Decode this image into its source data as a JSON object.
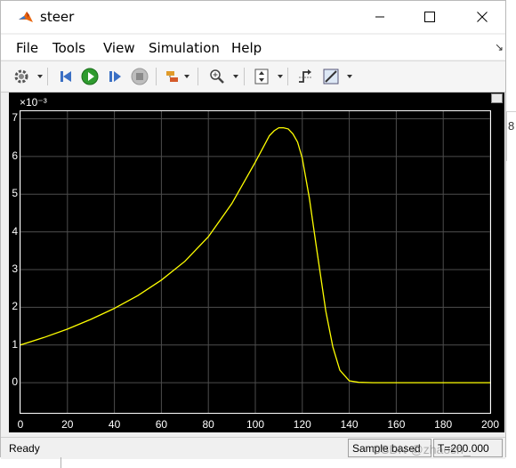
{
  "window": {
    "title": "steer"
  },
  "menu": {
    "file": "File",
    "tools": "Tools",
    "view": "View",
    "simulation": "Simulation",
    "help": "Help"
  },
  "toolbar": {
    "items": [
      "gear-icon",
      "step-back-icon",
      "run-icon",
      "step-forward-icon",
      "stop-icon",
      "highlight-icon",
      "zoom-icon",
      "autoscale-icon",
      "triggers-icon",
      "measurements-icon"
    ]
  },
  "plot": {
    "exponent_label": "×10⁻³",
    "colors": {
      "background": "#000000",
      "grid": "#4d4d4d",
      "line": "#ffff00",
      "axes": "#ffffff"
    }
  },
  "chart_data": {
    "type": "line",
    "xlim": [
      0,
      200
    ],
    "ylim": [
      -0.8,
      7.2
    ],
    "grid": true,
    "y_scale_note": "×10⁻³",
    "x_ticks": [
      0,
      20,
      40,
      60,
      80,
      100,
      120,
      140,
      160,
      180,
      200
    ],
    "y_ticks": [
      0,
      1,
      2,
      3,
      4,
      5,
      6,
      7
    ],
    "series": [
      {
        "color": "#ffff00",
        "x": [
          0,
          10,
          20,
          30,
          40,
          50,
          60,
          70,
          80,
          90,
          100,
          104,
          106,
          108,
          110,
          112,
          114,
          116,
          118,
          120,
          123,
          126,
          130,
          133,
          136,
          140,
          144,
          150,
          160,
          180,
          200
        ],
        "y": [
          1.0,
          1.2,
          1.42,
          1.68,
          1.97,
          2.31,
          2.72,
          3.22,
          3.87,
          4.75,
          5.85,
          6.32,
          6.55,
          6.68,
          6.76,
          6.76,
          6.73,
          6.6,
          6.38,
          5.95,
          4.9,
          3.6,
          1.9,
          0.95,
          0.33,
          0.05,
          0.01,
          0.0,
          0.0,
          0.0,
          0.0
        ]
      }
    ]
  },
  "status": {
    "ready": "Ready",
    "mode": "Sample based",
    "time": "T=200.000"
  },
  "watermark": "CSDN @zhaosh_",
  "background": {
    "edge_char": "8"
  }
}
